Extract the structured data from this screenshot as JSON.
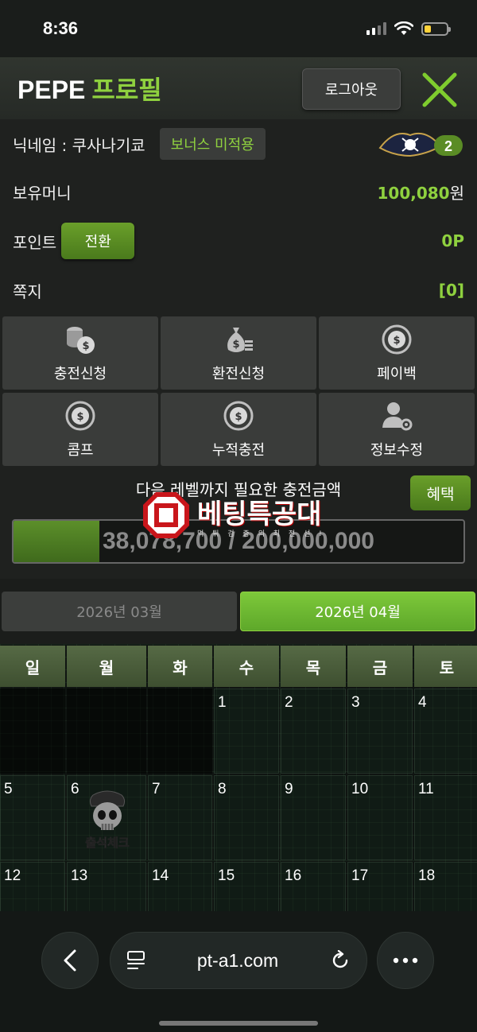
{
  "status_bar": {
    "time": "8:36"
  },
  "header": {
    "title": "PEPE",
    "title_accent": "프로필",
    "logout_label": "로그아웃"
  },
  "profile": {
    "nickname_label": "닉네임 : 쿠사나기쿄",
    "bonus_badge": "보너스 미적용",
    "level": "2",
    "money_label": "보유머니",
    "money_value": "100,080",
    "money_unit": "원",
    "point_label": "포인트",
    "convert_label": "전환",
    "point_value": "0P",
    "message_label": "쪽지",
    "message_value": "[0]"
  },
  "menu": [
    {
      "label": "충전신청",
      "icon": "coins-stack-icon"
    },
    {
      "label": "환전신청",
      "icon": "money-bag-icon"
    },
    {
      "label": "페이백",
      "icon": "coin-refresh-icon"
    },
    {
      "label": "콤프",
      "icon": "coin-refresh-icon"
    },
    {
      "label": "누적충전",
      "icon": "coin-refresh-icon"
    },
    {
      "label": "정보수정",
      "icon": "user-settings-icon"
    }
  ],
  "level_progress": {
    "caption": "다음 레벨까지 필요한 충전금액",
    "benefit_label": "혜택",
    "current": 38078700,
    "target": 200000000,
    "text": "38,078,700 / 200,000,000",
    "fraction": 0.19
  },
  "watermark": {
    "text": "베팅특공대",
    "sub": "먹 튀 검 증 의 최 전 선 !"
  },
  "calendar": {
    "prev_month": "2026년 03월",
    "current_month": "2026년 04월",
    "weekdays": [
      "일",
      "월",
      "화",
      "수",
      "목",
      "금",
      "토"
    ],
    "weeks": [
      [
        "",
        "",
        "",
        "1",
        "2",
        "3",
        "4"
      ],
      [
        "5",
        "6",
        "7",
        "8",
        "9",
        "10",
        "11"
      ],
      [
        "12",
        "13",
        "14",
        "15",
        "16",
        "17",
        "18"
      ]
    ],
    "attendance_stamp": "출석체크"
  },
  "browser": {
    "url": "pt-a1.com"
  },
  "colors": {
    "accent": "#8fd13f",
    "button_green": "#5a8c25",
    "panel": "#3a3c3a"
  }
}
